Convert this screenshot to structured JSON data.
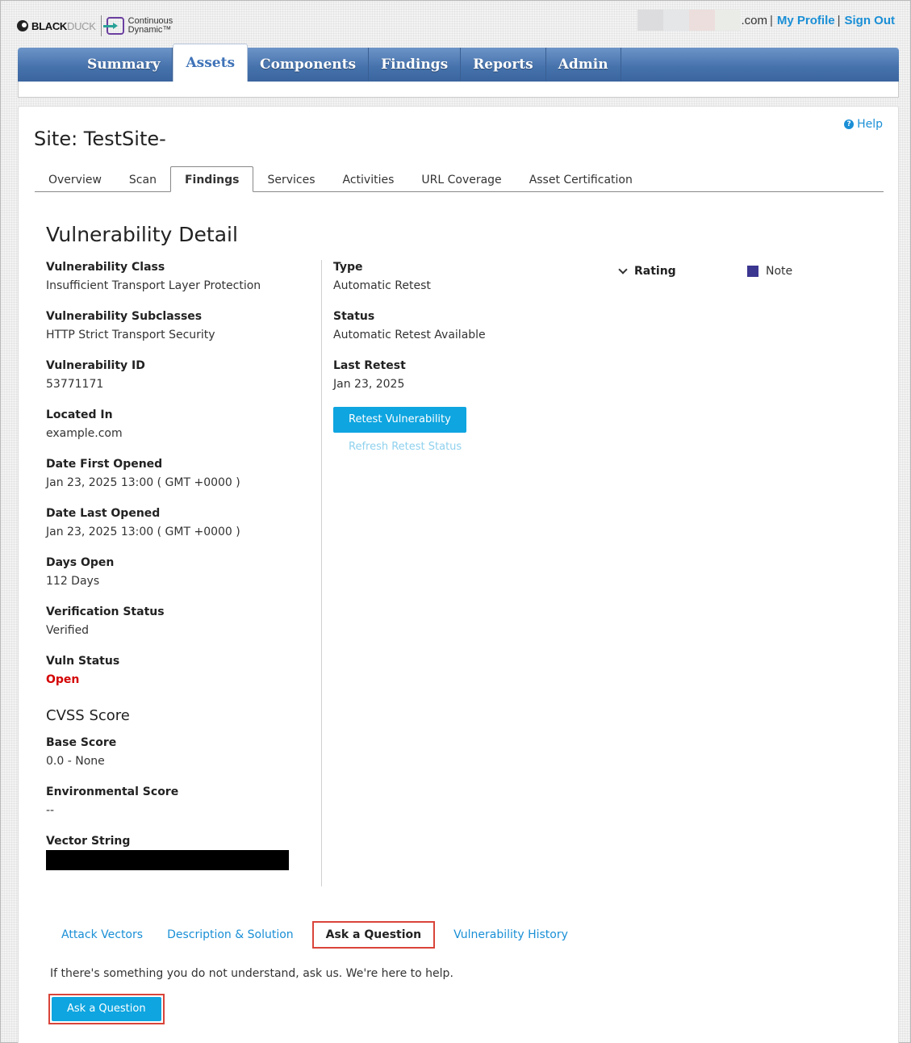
{
  "header": {
    "brand_black": "BLACK",
    "brand_duck": "DUCK",
    "product_line1": "Continuous",
    "product_line2": "Dynamic™",
    "user_domain": ".com",
    "separator": "|",
    "my_profile": "My Profile",
    "sign_out": "Sign Out"
  },
  "nav": {
    "items": [
      "Summary",
      "Assets",
      "Components",
      "Findings",
      "Reports",
      "Admin"
    ],
    "active": "Assets"
  },
  "page": {
    "help": "Help",
    "site_title": "Site: TestSite-",
    "tabs": [
      "Overview",
      "Scan",
      "Findings",
      "Services",
      "Activities",
      "URL Coverage",
      "Asset Certification"
    ],
    "active_tab": "Findings",
    "section_title": "Vulnerability Detail"
  },
  "details": {
    "vuln_class_label": "Vulnerability Class",
    "vuln_class": "Insufficient Transport Layer Protection",
    "vuln_subclasses_label": "Vulnerability Subclasses",
    "vuln_subclasses": "HTTP Strict Transport Security",
    "vuln_id_label": "Vulnerability ID",
    "vuln_id": "53771171",
    "located_in_label": "Located In",
    "located_in": "example.com",
    "first_opened_label": "Date First Opened",
    "first_opened": "Jan 23, 2025 13:00 ( GMT +0000 )",
    "last_opened_label": "Date Last Opened",
    "last_opened": "Jan 23, 2025 13:00 ( GMT +0000 )",
    "days_open_label": "Days Open",
    "days_open": "112 Days",
    "verification_label": "Verification Status",
    "verification": "Verified",
    "vuln_status_label": "Vuln Status",
    "vuln_status": "Open"
  },
  "cvss": {
    "title": "CVSS Score",
    "base_label": "Base Score",
    "base": "0.0 - None",
    "env_label": "Environmental Score",
    "env": "--",
    "vector_label": "Vector String"
  },
  "retest": {
    "type_label": "Type",
    "type": "Automatic Retest",
    "status_label": "Status",
    "status": "Automatic Retest Available",
    "last_label": "Last Retest",
    "last": "Jan 23, 2025",
    "retest_button": "Retest Vulnerability",
    "refresh_link": "Refresh Retest Status"
  },
  "rating": {
    "label": "Rating",
    "value": "Note",
    "color": "#3b3690"
  },
  "bottom": {
    "tabs": [
      "Attack Vectors",
      "Description & Solution",
      "Ask a Question",
      "Vulnerability History"
    ],
    "active_tab": "Ask a Question",
    "help_text": "If there's something you do not understand, ask us. We're here to help.",
    "ask_button": "Ask a Question"
  },
  "colors": {
    "link": "#1a8fd6",
    "primary_button": "#0ea5e0",
    "nav_bar": "#4773ad",
    "status_open": "#d40000",
    "highlight_border": "#d9443a"
  }
}
